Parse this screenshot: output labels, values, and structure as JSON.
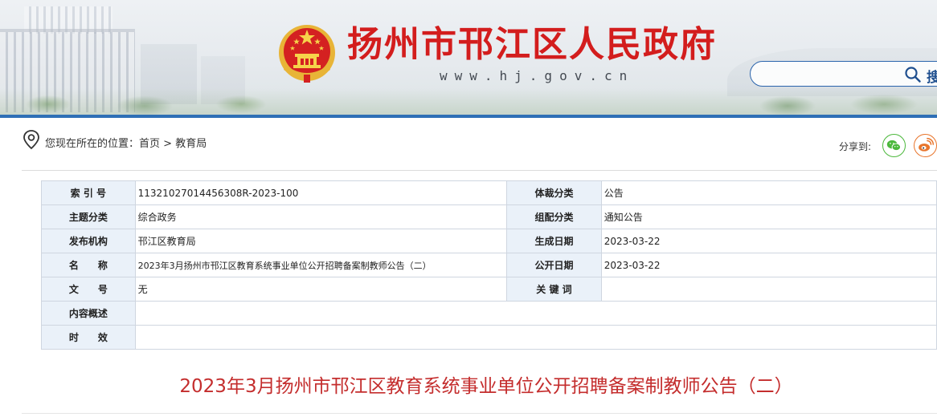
{
  "header": {
    "site_title": "扬州市邗江区人民政府",
    "site_url": "www.hj.gov.cn",
    "search_label": "搜"
  },
  "breadcrumb": {
    "prefix": "您现在所在的位置：",
    "home": "首页",
    "separator": " > ",
    "current": "教育局"
  },
  "share": {
    "label": "分享到:",
    "icons": [
      "wechat-icon",
      "weibo-icon"
    ]
  },
  "meta_table": {
    "rows": [
      {
        "l1": "索 引 号",
        "v1": "11321027014456308R-2023-100",
        "l2": "体裁分类",
        "v2": "公告"
      },
      {
        "l1": "主题分类",
        "v1": "综合政务",
        "l2": "组配分类",
        "v2": "通知公告"
      },
      {
        "l1": "发布机构",
        "v1": "邗江区教育局",
        "l2": "生成日期",
        "v2": "2023-03-22"
      },
      {
        "l1": "名　　称",
        "v1": "2023年3月扬州市邗江区教育系统事业单位公开招聘备案制教师公告（二）",
        "l2": "公开日期",
        "v2": "2023-03-22"
      },
      {
        "l1": "文　　号",
        "v1": "无",
        "l2": "关 键 词",
        "v2": ""
      }
    ],
    "summary_label": "内容概述",
    "summary_value": "",
    "validity_label": "时　　效",
    "validity_value": ""
  },
  "document": {
    "title": "2023年3月扬州市邗江区教育系统事业单位公开招聘备案制教师公告（二）"
  },
  "colors": {
    "title_red": "#d31d1d",
    "doc_title_red": "#c42d2d",
    "accent_blue": "#2e6fb6",
    "label_bg": "#eaf1f9",
    "wechat_green": "#4cb83c",
    "weibo_orange": "#e8752c"
  }
}
